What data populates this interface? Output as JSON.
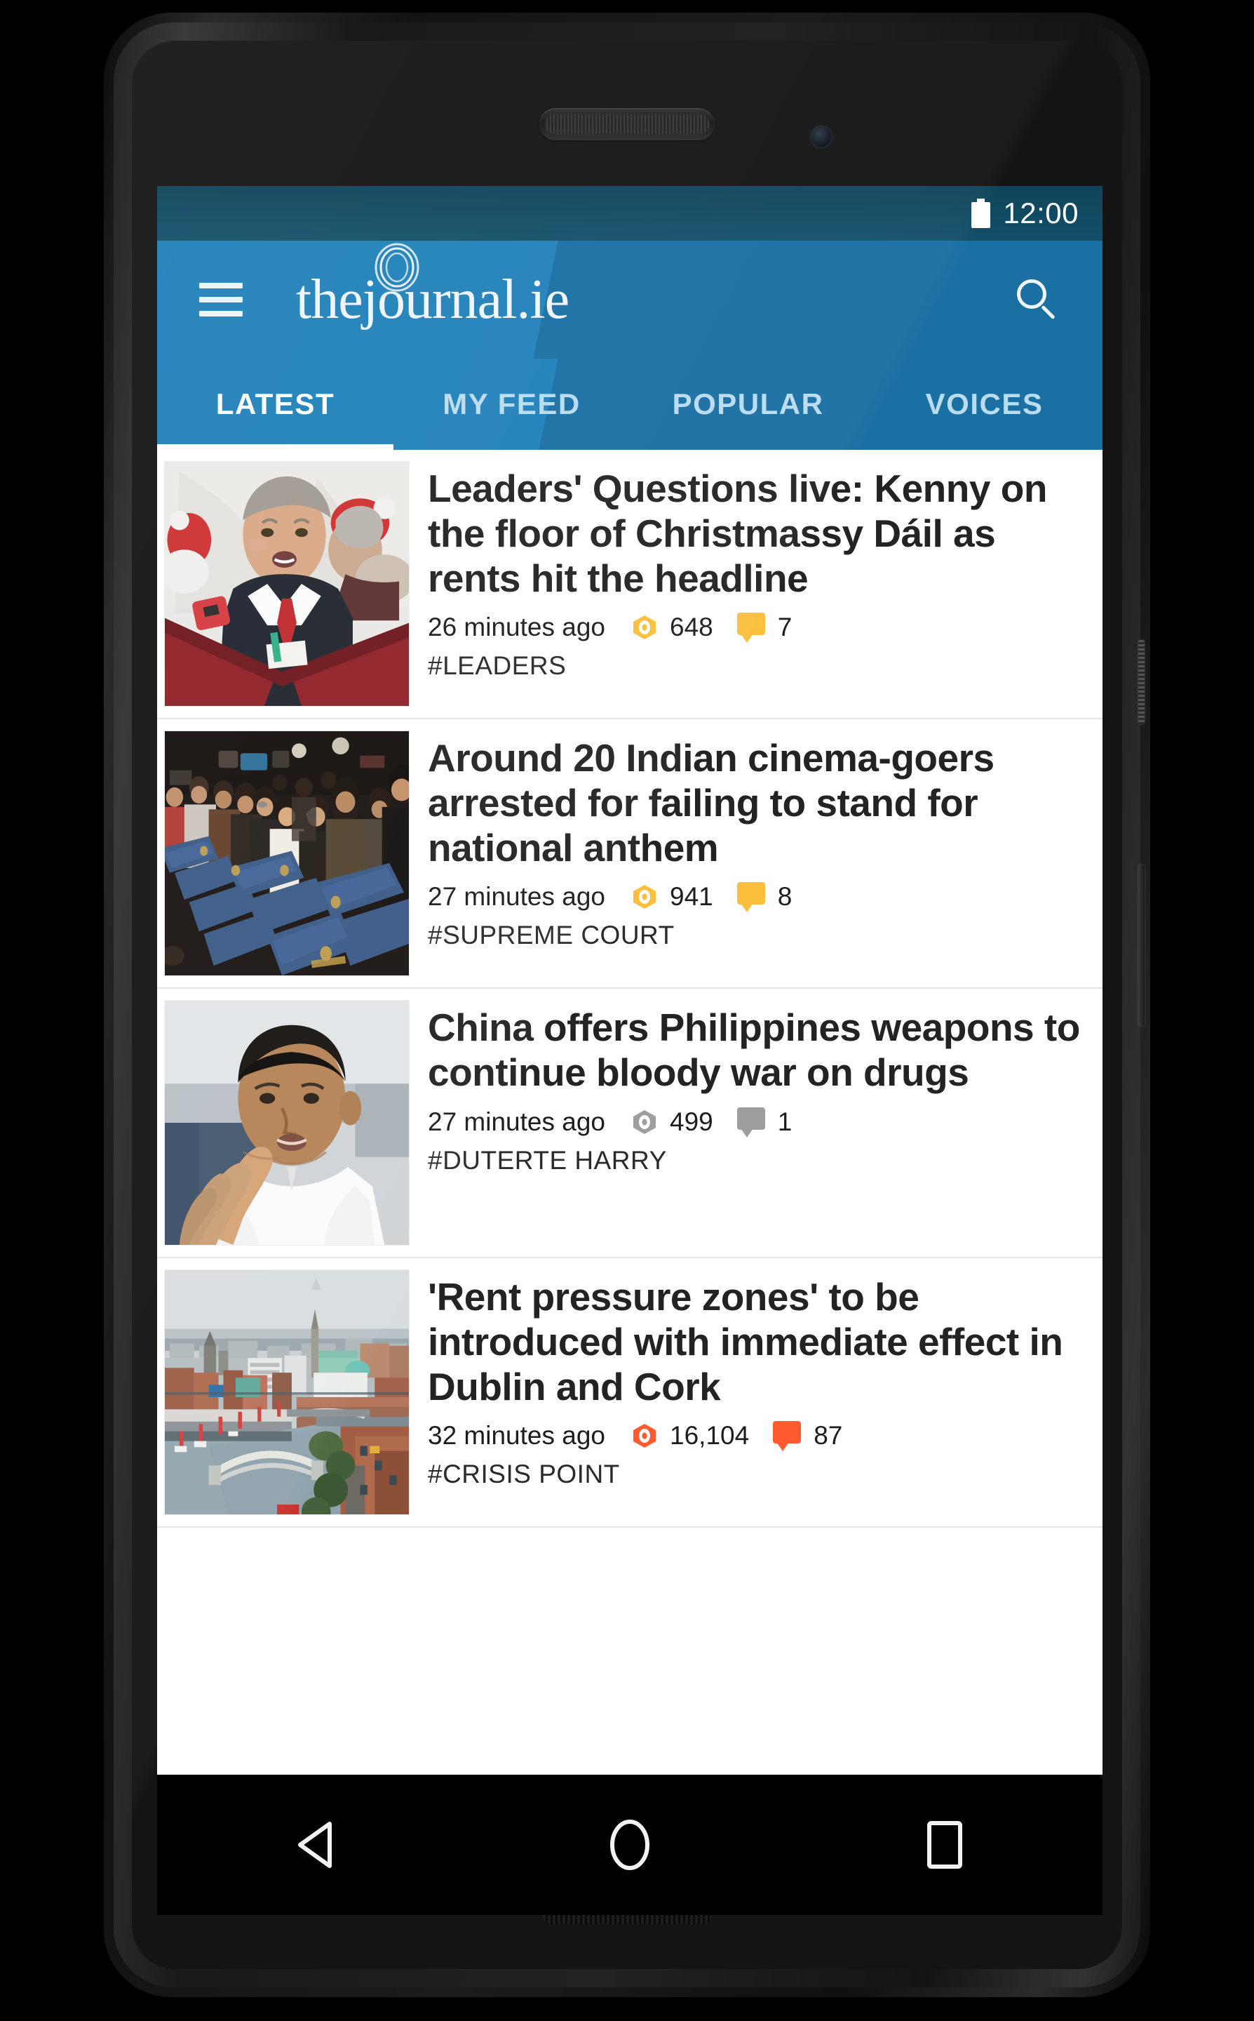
{
  "status_bar": {
    "clock": "12:00",
    "battery_icon": "battery-full-icon"
  },
  "app_bar": {
    "menu_icon": "hamburger-menu-icon",
    "brand_pre": "thej",
    "brand_o": "o",
    "brand_post": "urnal.ie",
    "brand_full": "thejournal.ie",
    "search_icon": "search-icon"
  },
  "tabs": [
    {
      "label": "LATEST",
      "active": true
    },
    {
      "label": "MY FEED",
      "active": false
    },
    {
      "label": "POPULAR",
      "active": false
    },
    {
      "label": "VOICES",
      "active": false
    }
  ],
  "articles": [
    {
      "headline": "Leaders' Questions live: Kenny on the floor of Christmassy Dáil as rents hit the headline",
      "time": "26 minutes ago",
      "views": "648",
      "comments": "7",
      "tag": "#LEADERS",
      "icon_color": "#fbbf3c",
      "thumb_alt": "enda-kenny-at-christmas-event"
    },
    {
      "headline": "Around 20 Indian cinema-goers arrested for failing to stand for national anthem",
      "time": "27 minutes ago",
      "views": "941",
      "comments": "8",
      "tag": "#SUPREME COURT",
      "icon_color": "#fbbf3c",
      "thumb_alt": "cinema-audience-standing"
    },
    {
      "headline": "China offers Philippines weapons to continue bloody war on drugs",
      "time": "27 minutes ago",
      "views": "499",
      "comments": "1",
      "tag": "#DUTERTE HARRY",
      "icon_color": "#9e9e9e",
      "thumb_alt": "rodrigo-duterte-portrait"
    },
    {
      "headline": "'Rent pressure zones' to be introduced with immediate effect in Dublin and Cork",
      "time": "32 minutes ago",
      "views": "16,104",
      "comments": "87",
      "tag": "#CRISIS POINT",
      "icon_color": "#ff5b2e",
      "thumb_alt": "dublin-city-aerial-liffey"
    }
  ],
  "nav_bar": {
    "back_icon": "back-triangle-icon",
    "home_icon": "home-circle-icon",
    "recents_icon": "recents-square-icon"
  },
  "colors": {
    "app_bar_blue": "#2081b9",
    "app_bar_shade": "#1a6fa3",
    "status_bar_blue": "#11485f",
    "accent_yellow": "#fbbf3c",
    "accent_orange": "#ff5b2e",
    "accent_gray": "#9e9e9e"
  }
}
